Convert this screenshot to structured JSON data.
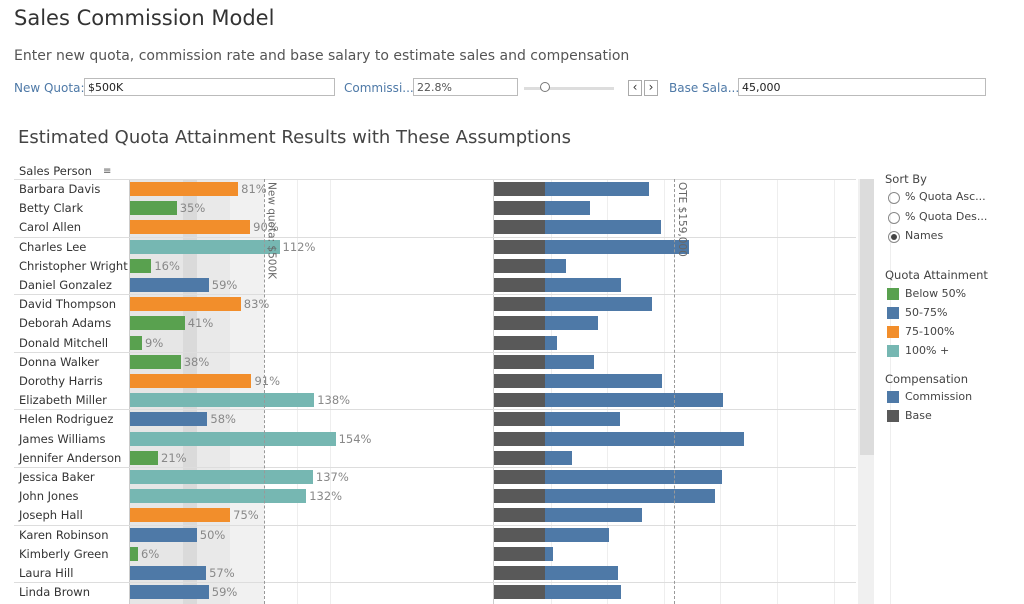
{
  "title": "Sales Commission Model",
  "subtitle": "Enter new quota, commission rate and base salary to estimate sales and compensation",
  "params": {
    "quota_label": "New Quota:",
    "quota_value": "$500K",
    "commission_label": "Commissi...",
    "commission_value": "22.8%",
    "commission_slider": 0.228,
    "base_label": "Base Sala...",
    "base_value": "45,000",
    "prev": "‹",
    "next": "›"
  },
  "section_title": "Estimated Quota Attainment Results with These Assumptions",
  "column_header": "Sales Person",
  "ref_lines": {
    "quota": "New quota: $500K",
    "ote": "OTE $159,000"
  },
  "colors": {
    "below50": "#59a14f",
    "50-75": "#4e79a7",
    "75-100": "#f28e2b",
    "100plus": "#76b7b2",
    "commission": "#4e79a7",
    "base": "#595959"
  },
  "legend": {
    "sort_title": "Sort By",
    "sort_options": [
      "% Quota Asc...",
      "% Quota Des...",
      "Names"
    ],
    "sort_selected": 2,
    "attain_title": "Quota Attainment",
    "attain_items": [
      "Below 50%",
      "50-75%",
      "75-100%",
      "100% +"
    ],
    "comp_title": "Compensation",
    "comp_items": [
      "Commission",
      "Base"
    ]
  },
  "chart_data": {
    "type": "bar",
    "base_salary": 45000,
    "commission_rate": 0.228,
    "quota": 500000,
    "ote": 159000,
    "rows": [
      {
        "name": "Barbara Davis",
        "attainment": 81,
        "label": "81%"
      },
      {
        "name": "Betty Clark",
        "attainment": 35,
        "label": "35%"
      },
      {
        "name": "Carol Allen",
        "attainment": 90,
        "label": "90%"
      },
      {
        "name": "Charles Lee",
        "attainment": 112,
        "label": "112%"
      },
      {
        "name": "Christopher Wright",
        "attainment": 16,
        "label": "16%"
      },
      {
        "name": "Daniel Gonzalez",
        "attainment": 59,
        "label": "59%"
      },
      {
        "name": "David Thompson",
        "attainment": 83,
        "label": "83%"
      },
      {
        "name": "Deborah Adams",
        "attainment": 41,
        "label": "41%"
      },
      {
        "name": "Donald Mitchell",
        "attainment": 9,
        "label": "9%"
      },
      {
        "name": "Donna Walker",
        "attainment": 38,
        "label": "38%"
      },
      {
        "name": "Dorothy Harris",
        "attainment": 91,
        "label": "91%"
      },
      {
        "name": "Elizabeth Miller",
        "attainment": 138,
        "label": "138%"
      },
      {
        "name": "Helen Rodriguez",
        "attainment": 58,
        "label": "58%"
      },
      {
        "name": "James Williams",
        "attainment": 154,
        "label": "154%"
      },
      {
        "name": "Jennifer Anderson",
        "attainment": 21,
        "label": "21%"
      },
      {
        "name": "Jessica Baker",
        "attainment": 137,
        "label": "137%"
      },
      {
        "name": "John Jones",
        "attainment": 132,
        "label": "132%"
      },
      {
        "name": "Joseph Hall",
        "attainment": 75,
        "label": "75%"
      },
      {
        "name": "Karen Robinson",
        "attainment": 50,
        "label": "50%"
      },
      {
        "name": "Kimberly Green",
        "attainment": 6,
        "label": "6%"
      },
      {
        "name": "Laura Hill",
        "attainment": 57,
        "label": "57%"
      },
      {
        "name": "Linda Brown",
        "attainment": 59,
        "label": "59%"
      }
    ]
  }
}
